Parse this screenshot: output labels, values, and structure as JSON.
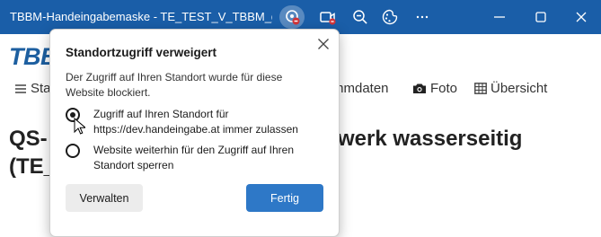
{
  "window": {
    "title": "TBBM-Handeingabemaske - TE_TEST_V_TBBM_groß •...",
    "accent_color": "#1a5ea8"
  },
  "page": {
    "logo_text": "TBB",
    "nav": {
      "item1": "Sta",
      "item2": "mmdaten",
      "item3": "Foto",
      "item4": "Übersicht"
    },
    "heading_line1_left": "QS-",
    "heading_line1_right": "werk wasserseitig",
    "heading_line2": "(TE_"
  },
  "popup": {
    "title": "Standortzugriff verweigert",
    "description": "Der Zugriff auf Ihren Standort wurde für diese Website blockiert.",
    "options": [
      {
        "label": "Zugriff auf Ihren Standort für https://dev.handeingabe.at immer zulassen",
        "checked": true
      },
      {
        "label": "Website weiterhin für den Zugriff auf Ihren Standort sperren",
        "checked": false
      }
    ],
    "manage_label": "Verwalten",
    "done_label": "Fertig"
  },
  "icons": {
    "location_blocked": "location-blocked-icon",
    "camera_blocked": "camera-blocked-icon",
    "zoom": "zoom-out-icon",
    "extensions": "extensions-icon",
    "close": "close-icon"
  }
}
